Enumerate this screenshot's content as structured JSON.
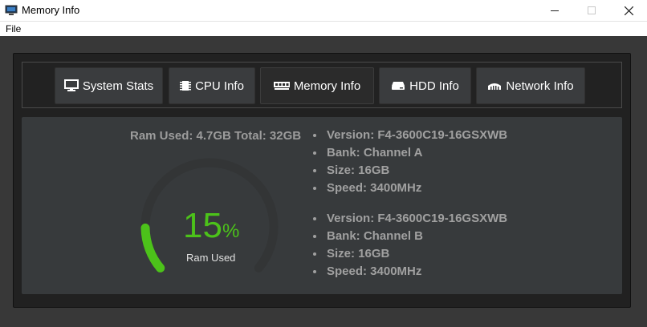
{
  "window": {
    "title": "Memory Info"
  },
  "menu": {
    "file": "File"
  },
  "nav": [
    {
      "label": "System Stats",
      "icon": "monitor-icon"
    },
    {
      "label": "CPU Info",
      "icon": "cpu-icon"
    },
    {
      "label": "Memory Info",
      "icon": "memory-icon",
      "active": true
    },
    {
      "label": "HDD Info",
      "icon": "hdd-icon"
    },
    {
      "label": "Network Info",
      "icon": "network-icon"
    }
  ],
  "ram": {
    "summary": "Ram Used: 4.7GB Total: 32GB",
    "percent": "15",
    "percent_symbol": "%",
    "percent_value": 15,
    "gauge_label": "Ram Used"
  },
  "modules": [
    {
      "version": "Version: F4-3600C19-16GSXWB",
      "bank": "Bank: Channel A",
      "size": "Size: 16GB",
      "speed": "Speed: 3400MHz"
    },
    {
      "version": "Version: F4-3600C19-16GSXWB",
      "bank": "Bank: Channel B",
      "size": "Size: 16GB",
      "speed": "Speed: 3400MHz"
    }
  ],
  "colors": {
    "accent_green": "#4cc21a",
    "gauge_track": "#333536",
    "window_bg": "#383838"
  }
}
